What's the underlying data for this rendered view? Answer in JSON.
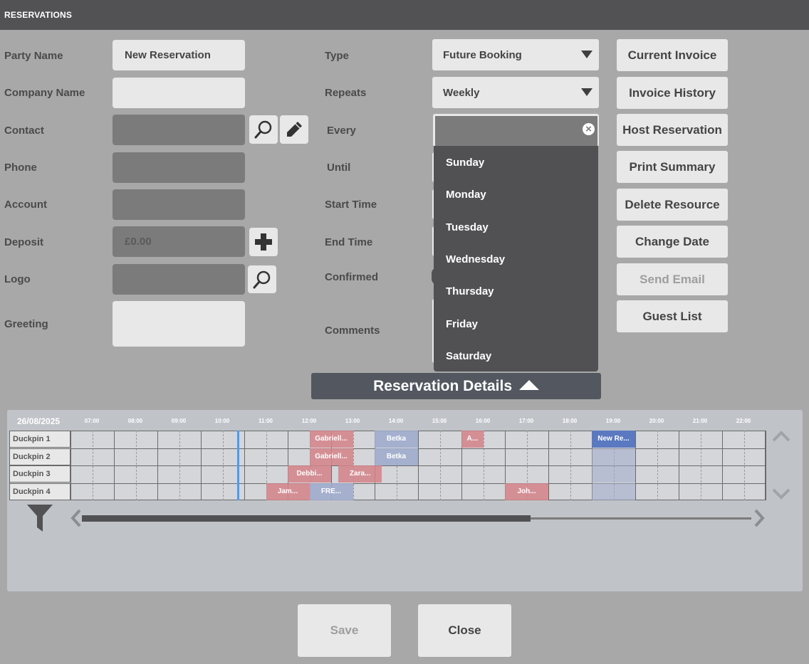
{
  "window": {
    "title": "RESERVATIONS"
  },
  "form_left": {
    "labels": {
      "party_name": "Party Name",
      "company_name": "Company Name",
      "contact": "Contact",
      "phone": "Phone",
      "account": "Account",
      "deposit": "Deposit",
      "logo": "Logo",
      "greeting": "Greeting"
    },
    "values": {
      "party_name": "New Reservation",
      "company_name": "",
      "contact": "",
      "phone": "",
      "account": "",
      "deposit": "£0.00",
      "logo": "",
      "greeting": ""
    }
  },
  "form_middle": {
    "labels": {
      "type": "Type",
      "repeats": "Repeats",
      "every": "Every",
      "until": "Until",
      "start_time": "Start Time",
      "end_time": "End Time",
      "confirmed": "Confirmed",
      "comments": "Comments"
    },
    "values": {
      "type": "Future Booking",
      "repeats": "Weekly"
    }
  },
  "every_dropdown": {
    "options": [
      "Sunday",
      "Monday",
      "Tuesday",
      "Wednesday",
      "Thursday",
      "Friday",
      "Saturday"
    ]
  },
  "actions": {
    "current_invoice": "Current Invoice",
    "invoice_history": "Invoice History",
    "host_reservation": "Host Reservation",
    "print_summary": "Print Summary",
    "delete_resource": "Delete Resource",
    "change_date": "Change Date",
    "send_email": "Send Email",
    "guest_list": "Guest List"
  },
  "details_toggle": {
    "label": "Reservation Details"
  },
  "timeline": {
    "date": "26/08/2025",
    "hours": [
      "07:00",
      "08:00",
      "09:00",
      "10:00",
      "11:00",
      "12:00",
      "13:00",
      "14:00",
      "15:00",
      "16:00",
      "17:00",
      "18:00",
      "19:00",
      "20:00",
      "21:00",
      "22:00"
    ],
    "lanes": [
      "Duckpin 1",
      "Duckpin 2",
      "Duckpin 3",
      "Duckpin 4"
    ],
    "bookings": [
      {
        "lane": 0,
        "start": "12:30",
        "end": "13:30",
        "label": "Gabriell...",
        "kind": "red"
      },
      {
        "lane": 0,
        "start": "14:00",
        "end": "15:00",
        "label": "Betka",
        "kind": "blue"
      },
      {
        "lane": 0,
        "start": "16:00",
        "end": "16:30",
        "label": "A...",
        "kind": "red"
      },
      {
        "lane": 0,
        "start": "19:00",
        "end": "20:00",
        "label": "New Re...",
        "kind": "selected"
      },
      {
        "lane": 1,
        "start": "12:30",
        "end": "13:30",
        "label": "Gabriell...",
        "kind": "red"
      },
      {
        "lane": 1,
        "start": "14:00",
        "end": "15:00",
        "label": "Betka",
        "kind": "blue"
      },
      {
        "lane": 2,
        "start": "12:00",
        "end": "13:00",
        "label": "Debbi...",
        "kind": "red"
      },
      {
        "lane": 2,
        "start": "13:10",
        "end": "14:10",
        "label": "Zara...",
        "kind": "red"
      },
      {
        "lane": 3,
        "start": "11:30",
        "end": "12:30",
        "label": "Jam...",
        "kind": "red"
      },
      {
        "lane": 3,
        "start": "12:30",
        "end": "13:30",
        "label": "FRE...",
        "kind": "blue"
      },
      {
        "lane": 3,
        "start": "17:00",
        "end": "18:00",
        "label": "Joh...",
        "kind": "red"
      }
    ],
    "scroll_position": 0.67
  },
  "footer": {
    "save": "Save",
    "close": "Close"
  },
  "colors": {
    "titlebar": "#525255",
    "accent_now": "#4b9bf0",
    "booking_red": "#d48288",
    "booking_blue": "#a0accc",
    "booking_selected": "#5a79c0"
  }
}
